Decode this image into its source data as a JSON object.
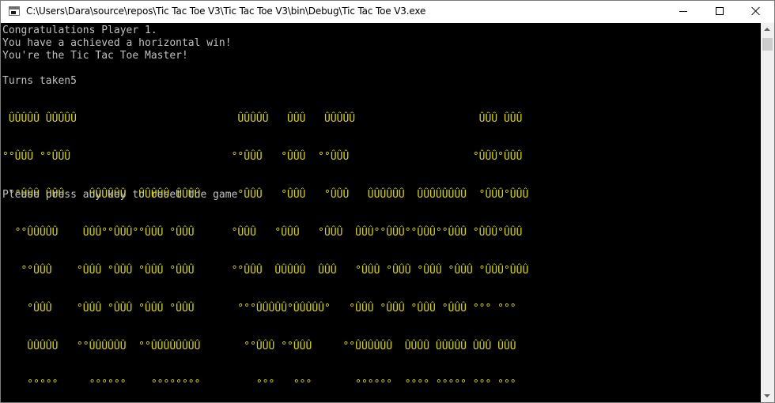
{
  "window": {
    "title": "C:\\Users\\Dara\\source\\repos\\Tic Tac Toe V3\\Tic Tac Toe V3\\bin\\Debug\\Tic Tac Toe V3.exe",
    "icon": "console-app-icon",
    "controls": {
      "minimize": "minimize-icon",
      "maximize": "maximize-icon",
      "close": "close-icon"
    }
  },
  "console": {
    "background": "#000000",
    "text_color": "#c0c0c0",
    "banner_color": "#d8d800",
    "lines": [
      "Congratulations Player 1.",
      "You have a achieved a horizontal win!",
      "You're the Tic Tac Toe Master!",
      "Turns taken5"
    ],
    "banner": [
      " ÛÛÛÛÛ ÛÛÛÛÛ                          ÛÛÛÛÛ   ÛÛÛ   ÛÛÛÛÛ                    ÛÛÛ ÛÛÛ",
      "°°ÛÛÛ °°ÛÛÛ                          °°ÛÛÛ   °ÛÛÛ  °°ÛÛÛ                    °ÛÛÛ°ÛÛÛ",
      " °°ÛÛÛ ÛÛÛ    ÛÛÛÛÛÛ  ÛÛÛÛÛ ÛÛÛÛ      °ÛÛÛ   °ÛÛÛ   °ÛÛÛ   ÛÛÛÛÛÛ  ÛÛÛÛÛÛÛÛ  °ÛÛÛ°ÛÛÛ",
      "  °°ÛÛÛÛÛ    ÛÛÛ°°ÛÛÛ°°ÛÛÛ °ÛÛÛ      °ÛÛÛ   °ÛÛÛ   °ÛÛÛ  ÛÛÛ°°ÛÛÛ°°ÛÛÛ°°ÛÛÛ °ÛÛÛ°ÛÛÛ",
      "   °°ÛÛÛ    °ÛÛÛ °ÛÛÛ °ÛÛÛ °ÛÛÛ      °°ÛÛÛ  ÛÛÛÛÛ  ÛÛÛ   °ÛÛÛ °ÛÛÛ °ÛÛÛ °ÛÛÛ °ÛÛÛ°ÛÛÛ",
      "    °ÛÛÛ    °ÛÛÛ °ÛÛÛ °ÛÛÛ °ÛÛÛ       °°°ÛÛÛÛÛ°ÛÛÛÛÛ°   °ÛÛÛ °ÛÛÛ °ÛÛÛ °ÛÛÛ °°° °°°",
      "    ÛÛÛÛÛ   °°ÛÛÛÛÛÛ  °°ÛÛÛÛÛÛÛÛ       °°ÛÛÛ °°ÛÛÛ     °°ÛÛÛÛÛÛ  ÛÛÛÛ ÛÛÛÛÛ ÛÛÛ ÛÛÛ",
      "    °°°°°     °°°°°°    °°°°°°°°         °°°   °°°       °°°°°°  °°°° °°°°° °°° °°°"
    ],
    "prompt": "Please press any key to reset the game"
  },
  "scrollbar": {
    "up": "scroll-up-arrow-icon",
    "down": "scroll-down-arrow-icon"
  }
}
